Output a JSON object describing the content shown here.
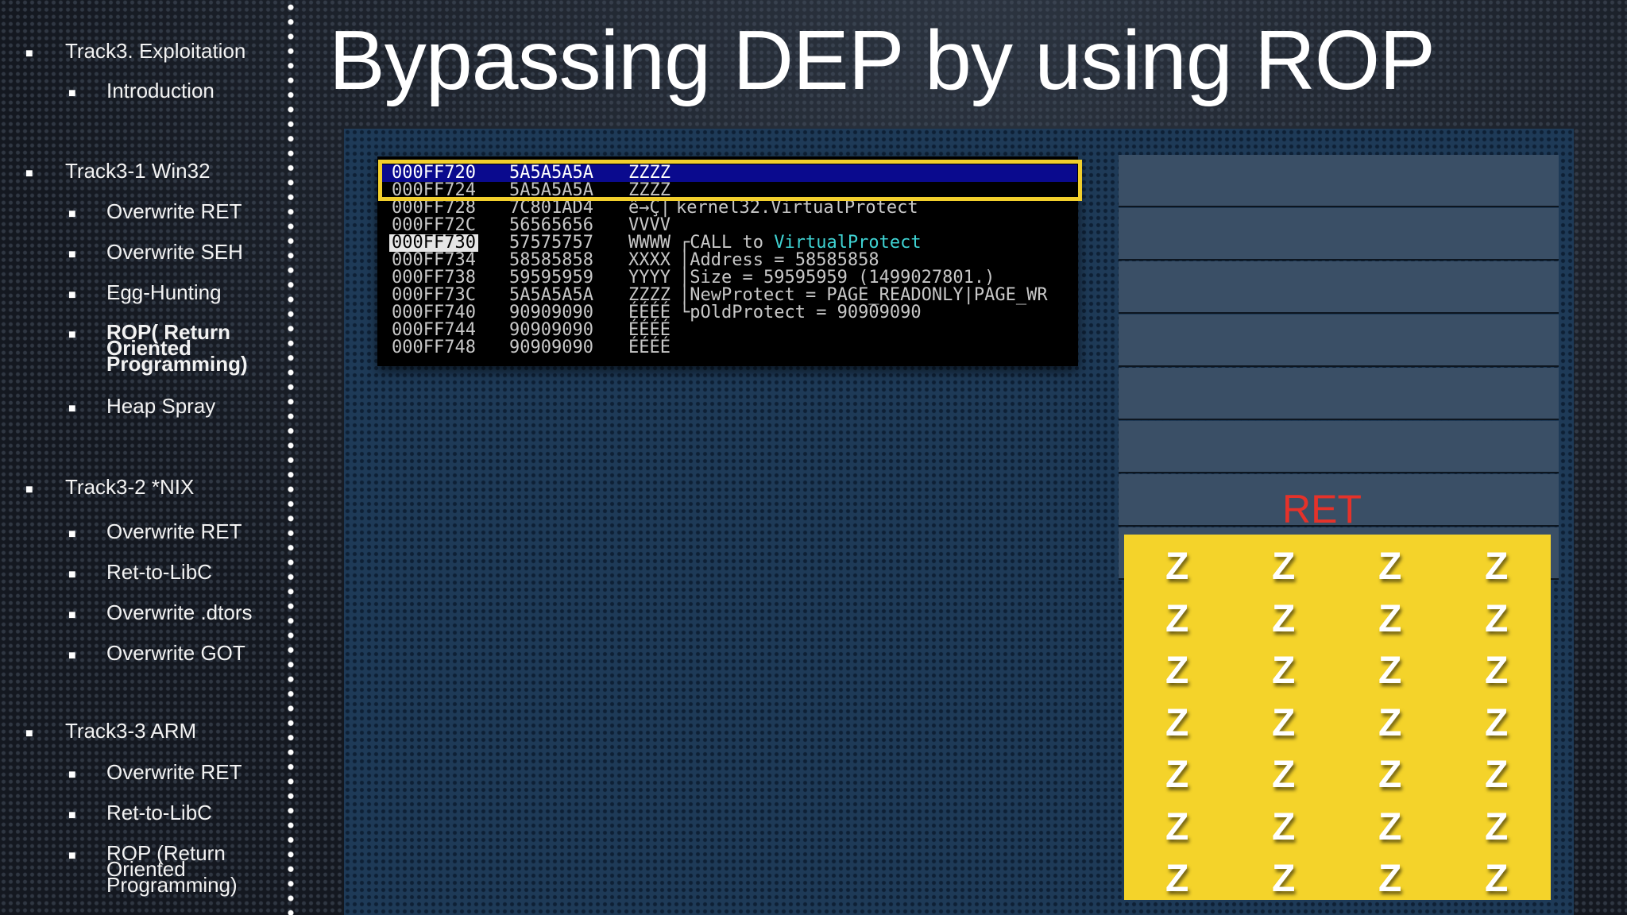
{
  "sidebar": {
    "items": [
      {
        "label": "Track3. Exploitation",
        "level": 1
      },
      {
        "label": "Introduction",
        "level": 2
      },
      {
        "label": "Track3-1 Win32",
        "level": 1
      },
      {
        "label": "Overwrite RET",
        "level": 2
      },
      {
        "label": "Overwrite SEH",
        "level": 2
      },
      {
        "label": "Egg-Hunting",
        "level": 2
      },
      {
        "label": "ROP( Return Oriented Programming)",
        "level": 2,
        "active": true
      },
      {
        "label": "Heap Spray",
        "level": 2
      },
      {
        "label": "Track3-2 *NIX",
        "level": 1
      },
      {
        "label": "Overwrite RET",
        "level": 2
      },
      {
        "label": "Ret-to-LibC",
        "level": 2
      },
      {
        "label": "Overwrite .dtors",
        "level": 2
      },
      {
        "label": "Overwrite GOT",
        "level": 2
      },
      {
        "label": "Track3-3 ARM",
        "level": 1
      },
      {
        "label": "Overwrite RET",
        "level": 2
      },
      {
        "label": "Ret-to-LibC",
        "level": 2
      },
      {
        "label": "ROP (Return Oriented Programming)",
        "level": 2
      }
    ]
  },
  "slide": {
    "title": "Bypassing DEP by using ROP"
  },
  "debugger": {
    "rows": [
      {
        "addr": "000FF720",
        "val": "5A5A5A5A",
        "ascii": "ZZZZ",
        "comment": ""
      },
      {
        "addr": "000FF724",
        "val": "5A5A5A5A",
        "ascii": "ZZZZ",
        "comment": ""
      },
      {
        "addr": "000FF728",
        "val": "7C801AD4",
        "ascii": "ê→Ç|",
        "comment": "kernel32.VirtualProtect"
      },
      {
        "addr": "000FF72C",
        "val": "56565656",
        "ascii": "VVVV",
        "comment": ""
      },
      {
        "addr": "000FF730",
        "val": "57575757",
        "ascii": "WWWW",
        "comment": "CALL to ",
        "comment_fn": "VirtualProtect"
      },
      {
        "addr": "000FF734",
        "val": "58585858",
        "ascii": "XXXX",
        "comment": "Address = 58585858"
      },
      {
        "addr": "000FF738",
        "val": "59595959",
        "ascii": "YYYY",
        "comment": "Size = 59595959 (1499027801.)"
      },
      {
        "addr": "000FF73C",
        "val": "5A5A5A5A",
        "ascii": "ZZZZ",
        "comment": "NewProtect = PAGE_READONLY|PAGE_WR"
      },
      {
        "addr": "000FF740",
        "val": "90909090",
        "ascii": "ÉÉÉÉ",
        "comment": "pOldProtect = 90909090"
      },
      {
        "addr": "000FF744",
        "val": "90909090",
        "ascii": "ÉÉÉÉ",
        "comment": ""
      },
      {
        "addr": "000FF748",
        "val": "90909090",
        "ascii": "ÉÉÉÉ",
        "comment": ""
      }
    ],
    "bracket_top": "┌",
    "bracket_mid": "│",
    "bracket_bot": "└"
  },
  "stack": {
    "ret_label": "RET",
    "payload_char": "Z",
    "colors": {
      "ret": "#e5322a",
      "payload": "#f4d32a",
      "highlight_border": "#f2cf2c",
      "selection": "#0a0a8e"
    }
  }
}
